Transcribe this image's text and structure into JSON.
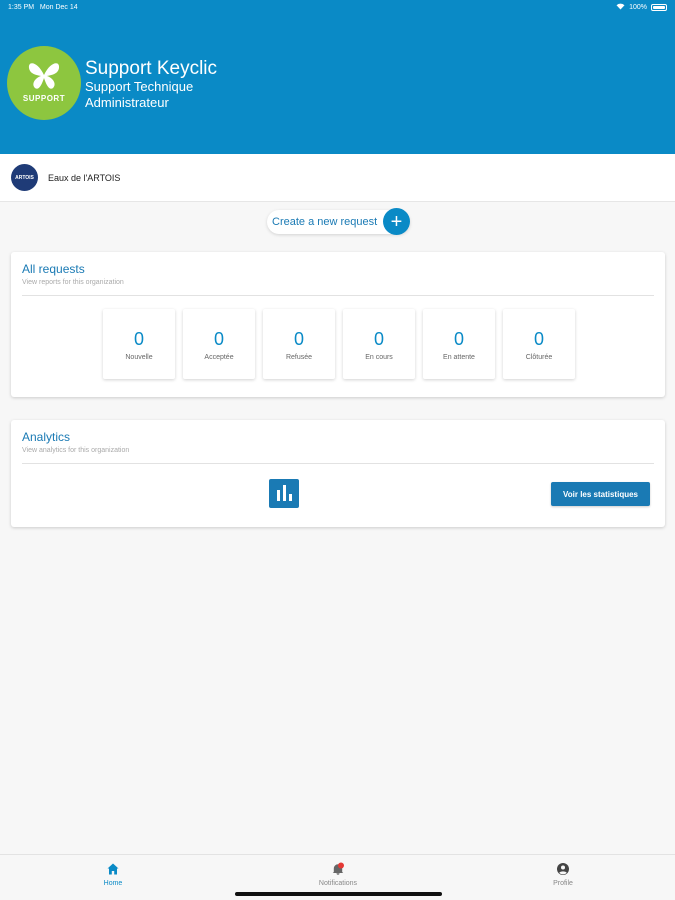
{
  "status_bar": {
    "time": "1:35 PM",
    "date": "Mon Dec 14",
    "battery": "100%"
  },
  "header": {
    "logo_text": "SUPPORT",
    "title": "Support Keyclic",
    "subtitle_1": "Support Technique",
    "subtitle_2": "Administrateur"
  },
  "organization": {
    "logo_text": "ARTOIS",
    "name": "Eaux de l'ARTOIS"
  },
  "create_request": {
    "label": "Create a new request",
    "icon": "plus-icon"
  },
  "requests_card": {
    "title": "All requests",
    "subtitle": "View reports for this organization",
    "stats": [
      {
        "value": "0",
        "label": "Nouvelle"
      },
      {
        "value": "0",
        "label": "Acceptée"
      },
      {
        "value": "0",
        "label": "Refusée"
      },
      {
        "value": "0",
        "label": "En cours"
      },
      {
        "value": "0",
        "label": "En attente"
      },
      {
        "value": "0",
        "label": "Clôturée"
      }
    ]
  },
  "analytics_card": {
    "title": "Analytics",
    "subtitle": "View analytics for this organization",
    "button_label": "Voir les statistiques",
    "icon": "bar-chart-icon"
  },
  "bottom_nav": [
    {
      "label": "Home",
      "icon": "home-icon",
      "active": true
    },
    {
      "label": "Notifications",
      "icon": "bell-icon",
      "active": false
    },
    {
      "label": "Profile",
      "icon": "user-icon",
      "active": false
    }
  ],
  "colors": {
    "primary": "#0a8ac6",
    "logo_green": "#8dc63f",
    "dark_blue": "#1a7ab4"
  }
}
